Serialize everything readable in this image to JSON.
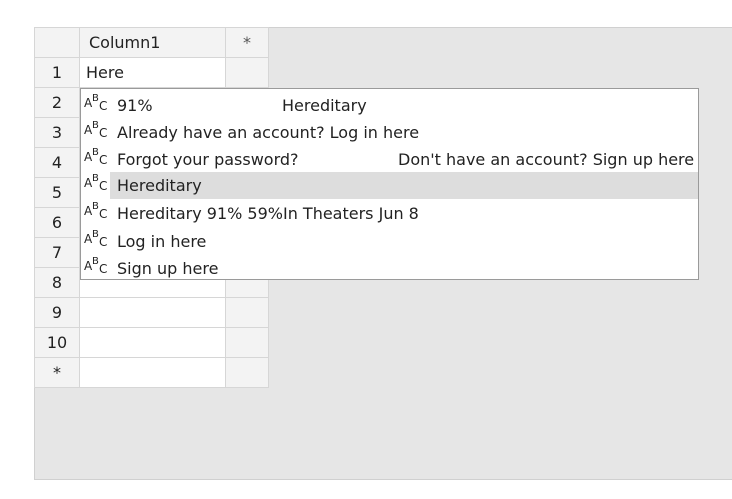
{
  "grid": {
    "header": {
      "column1": "Column1",
      "add_column": "*"
    },
    "rows": [
      {
        "num": "1",
        "value": "Here"
      },
      {
        "num": "2",
        "value": ""
      },
      {
        "num": "3",
        "value": ""
      },
      {
        "num": "4",
        "value": ""
      },
      {
        "num": "5",
        "value": ""
      },
      {
        "num": "6",
        "value": ""
      },
      {
        "num": "7",
        "value": ""
      },
      {
        "num": "8",
        "value": ""
      },
      {
        "num": "9",
        "value": ""
      },
      {
        "num": "10",
        "value": ""
      }
    ],
    "new_row": "*"
  },
  "autocomplete": {
    "icon": "abc-text-type-icon",
    "items": [
      {
        "text": "91%",
        "extra": "Hereditary"
      },
      {
        "text": "Already have an account? Log in here",
        "extra": ""
      },
      {
        "text": "Forgot your password?",
        "extra": "Don't have an account? Sign up here"
      },
      {
        "text": "Hereditary",
        "extra": ""
      },
      {
        "text": "Hereditary 91% 59%In Theaters Jun 8",
        "extra": ""
      },
      {
        "text": "Log in here",
        "extra": ""
      },
      {
        "text": "Sign up here",
        "extra": ""
      }
    ],
    "selected_index": 3
  },
  "colors": {
    "selected_bg": "#dddddd",
    "header_bg": "#f3f3f3",
    "canvas_bg": "#e6e6e6"
  }
}
